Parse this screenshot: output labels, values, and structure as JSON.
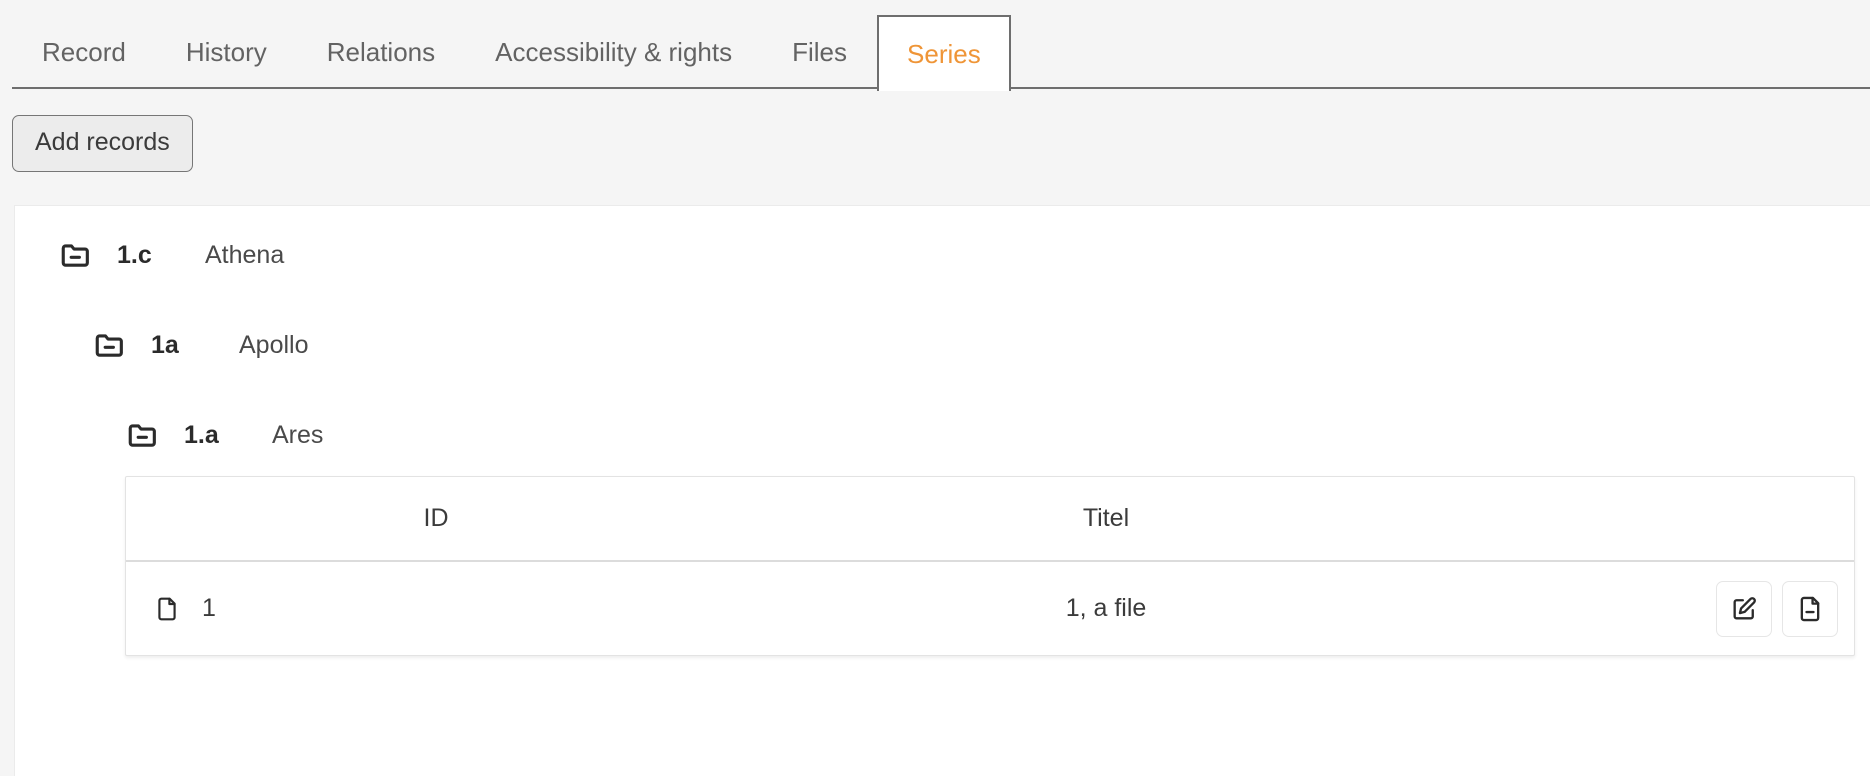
{
  "tabs": [
    {
      "label": "Record",
      "active": false
    },
    {
      "label": "History",
      "active": false
    },
    {
      "label": "Relations",
      "active": false
    },
    {
      "label": "Accessibility & rights",
      "active": false
    },
    {
      "label": "Files",
      "active": false
    },
    {
      "label": "Series",
      "active": true
    }
  ],
  "toolbar": {
    "add_records_label": "Add records"
  },
  "tree": {
    "nodes": [
      {
        "icon": "folder-minus-icon",
        "code": "1.c",
        "title": "Athena",
        "level": 0
      },
      {
        "icon": "folder-minus-icon",
        "code": "1a",
        "title": "Apollo",
        "level": 1
      },
      {
        "icon": "folder-minus-icon",
        "code": "1.a",
        "title": "Ares",
        "level": 2
      }
    ]
  },
  "table": {
    "columns": [
      {
        "key": "id",
        "label": "ID"
      },
      {
        "key": "titel",
        "label": "Titel"
      },
      {
        "key": "actions",
        "label": ""
      }
    ],
    "rows": [
      {
        "icon": "file-icon",
        "id": "1",
        "titel": "1, a file",
        "actions": [
          {
            "name": "edit-record-button",
            "icon": "pencil-square-icon"
          },
          {
            "name": "remove-record-button",
            "icon": "file-minus-icon"
          }
        ]
      }
    ]
  },
  "colors": {
    "accent": "#ef9537",
    "tab_inactive_text": "#636363",
    "tab_border": "#6e6e6e",
    "page_background": "#f5f5f5",
    "card_background": "#ffffff",
    "body_text": "#3b3b3b"
  }
}
